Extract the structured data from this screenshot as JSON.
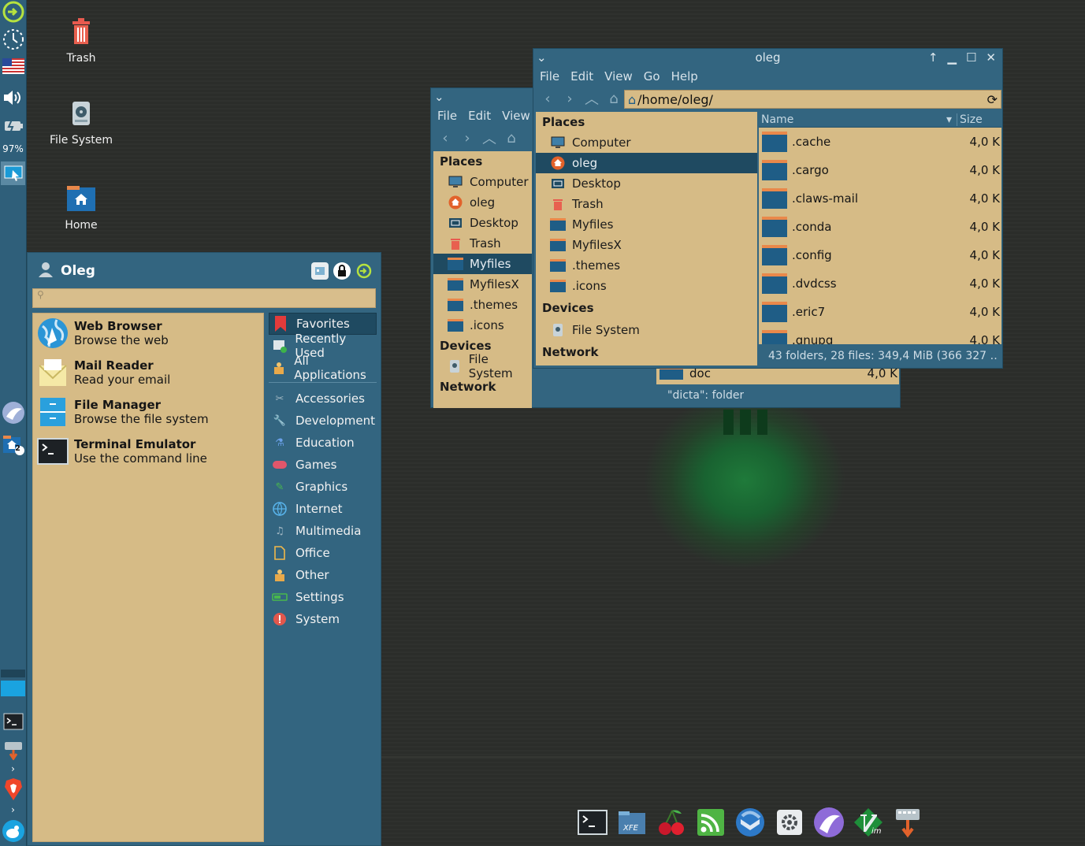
{
  "desktop": {
    "icons": [
      {
        "label": "Trash",
        "icon": "trash-icon"
      },
      {
        "label": "File System",
        "icon": "drive-icon"
      },
      {
        "label": "Home",
        "icon": "home-folder-icon"
      }
    ]
  },
  "panel": {
    "battery_text": "97%",
    "badge_count": "2"
  },
  "menu": {
    "user": "Oleg",
    "search_placeholder": "",
    "favorites": [
      {
        "title": "Web Browser",
        "subtitle": "Browse the web"
      },
      {
        "title": "Mail Reader",
        "subtitle": "Read your email"
      },
      {
        "title": "File Manager",
        "subtitle": "Browse the file system"
      },
      {
        "title": "Terminal Emulator",
        "subtitle": "Use the command line"
      }
    ],
    "top_categories": [
      "Favorites",
      "Recently Used",
      "All Applications"
    ],
    "categories": [
      "Accessories",
      "Development",
      "Education",
      "Games",
      "Graphics",
      "Internet",
      "Multimedia",
      "Office",
      "Other",
      "Settings",
      "System"
    ]
  },
  "back_window": {
    "menus": [
      "File",
      "Edit",
      "View"
    ],
    "places_header": "Places",
    "places": [
      "Computer",
      "oleg",
      "Desktop",
      "Trash",
      "Myfiles",
      "MyfilesX",
      ".themes",
      ".icons"
    ],
    "devices_header": "Devices",
    "devices": [
      "File System"
    ],
    "network_header": "Network",
    "partial_row": {
      "name": "doc",
      "size": "4,0 K"
    },
    "status": "\"dicta\": folder"
  },
  "front_window": {
    "title": "oleg",
    "menus": [
      "File",
      "Edit",
      "View",
      "Go",
      "Help"
    ],
    "path": "/home/oleg/",
    "places_header": "Places",
    "places": [
      "Computer",
      "oleg",
      "Desktop",
      "Trash",
      "Myfiles",
      "MyfilesX",
      ".themes",
      ".icons"
    ],
    "devices_header": "Devices",
    "devices": [
      "File System"
    ],
    "network_header": "Network",
    "columns": {
      "name": "Name",
      "size": "Size"
    },
    "rows": [
      {
        "name": ".cache",
        "size": "4,0 K"
      },
      {
        "name": ".cargo",
        "size": "4,0 K"
      },
      {
        "name": ".claws-mail",
        "size": "4,0 K"
      },
      {
        "name": ".conda",
        "size": "4,0 K"
      },
      {
        "name": ".config",
        "size": "4,0 K"
      },
      {
        "name": ".dvdcss",
        "size": "4,0 K"
      },
      {
        "name": ".eric7",
        "size": "4,0 K"
      },
      {
        "name": ".gnupg",
        "size": "4,0 K"
      }
    ],
    "status": "43 folders, 28 files: 349,4 MiB (366 327 …"
  },
  "dock": [
    "terminal-icon",
    "xfe-icon",
    "cherry-icon",
    "rss-icon",
    "thunderbird-icon",
    "settings-icon",
    "eagle-icon",
    "vim-icon",
    "keyboard-icon"
  ]
}
